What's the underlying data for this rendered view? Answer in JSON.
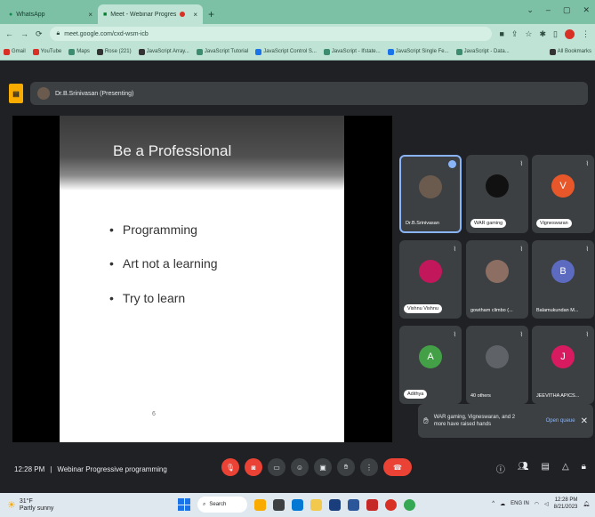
{
  "browser": {
    "tabs": [
      {
        "label": "WhatsApp",
        "active": false
      },
      {
        "label": "Meet - Webinar Progressiv",
        "active": true
      }
    ],
    "url": "meet.google.com/cxd-wsm-icb",
    "bookmarks": [
      "Gmail",
      "YouTube",
      "Maps",
      "Rose (221)",
      "JavaScript Array...",
      "JavaScript Tutorial",
      "JavaScript Control S...",
      "JavaScript - Ifstate...",
      "JavaScript Single Fe...",
      "JavaScript - Data..."
    ],
    "all_bookmarks": "All Bookmarks"
  },
  "meet": {
    "presenter_label": "Dr.B.Srinivasan (Presenting)",
    "slide": {
      "title": "Be a Professional",
      "bullets": [
        "Programming",
        "Art not a learning",
        "Try to learn"
      ],
      "page": "6"
    },
    "participants": [
      {
        "name": "Dr.B.Srinivasan",
        "initial": "",
        "color": "#6b5b4e",
        "pill": false,
        "speaking": true
      },
      {
        "name": "WAR gaming",
        "initial": "",
        "color": "#111111",
        "pill": true,
        "speaking": false
      },
      {
        "name": "Vigneswaran",
        "initial": "V",
        "color": "#e8572a",
        "pill": true,
        "speaking": false
      },
      {
        "name": "Vishnu Vishnu",
        "initial": "",
        "color": "#c2185b",
        "pill": true,
        "speaking": false
      },
      {
        "name": "gowtham climbo (...",
        "initial": "",
        "color": "#8d6e63",
        "pill": false,
        "speaking": false
      },
      {
        "name": "Balamukundan M...",
        "initial": "B",
        "color": "#5c6bc0",
        "pill": false,
        "speaking": false
      },
      {
        "name": "Adithya",
        "initial": "A",
        "color": "#43a047",
        "pill": true,
        "speaking": false
      },
      {
        "name": "40 others",
        "initial": "",
        "color": "#5f6368",
        "pill": false,
        "speaking": false
      },
      {
        "name": "JEEVITHA APICS...",
        "initial": "J",
        "color": "#d81b60",
        "pill": false,
        "speaking": false
      }
    ],
    "hand_banner": {
      "text": "WAR gaming, Vigneswaran, and 2 more have raised hands",
      "action": "Open queue"
    },
    "time": "12:28 PM",
    "meeting_title": "Webinar Progressive programming"
  },
  "taskbar": {
    "weather_temp": "31°F",
    "weather_desc": "Partly sunny",
    "search": "Search",
    "clock_time": "12:28 PM",
    "clock_date": "8/21/2023",
    "lang": "ENG IN"
  }
}
